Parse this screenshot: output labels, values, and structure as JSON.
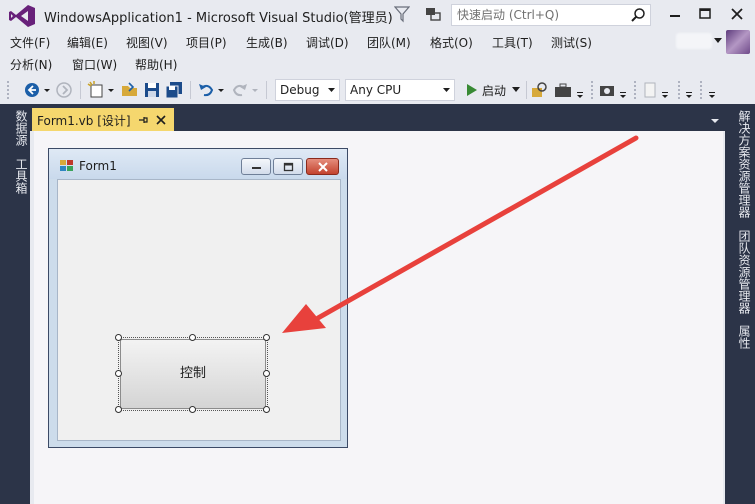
{
  "window": {
    "title": "WindowsApplication1 - Microsoft Visual Studio(管理员)",
    "quick_launch_placeholder": "快速启动 (Ctrl+Q)"
  },
  "menu": {
    "row1": [
      "文件(F)",
      "编辑(E)",
      "视图(V)",
      "项目(P)",
      "生成(B)",
      "调试(D)",
      "团队(M)",
      "格式(O)",
      "工具(T)",
      "测试(S)"
    ],
    "row2": [
      "分析(N)",
      "窗口(W)",
      "帮助(H)"
    ]
  },
  "toolbar": {
    "configuration": "Debug",
    "platform": "Any CPU",
    "start_label": "启动"
  },
  "left_panels": [
    "数据源",
    "工具箱"
  ],
  "right_panels": [
    "解决方案资源管理器",
    "团队资源管理器",
    "属性"
  ],
  "document_tab": {
    "name": "Form1.vb [设计]"
  },
  "form": {
    "title": "Form1",
    "button_text": "控制"
  },
  "colors": {
    "accent_tab": "#f5d76e",
    "rail": "#2c3448",
    "annotation_arrow": "#e8413c"
  }
}
